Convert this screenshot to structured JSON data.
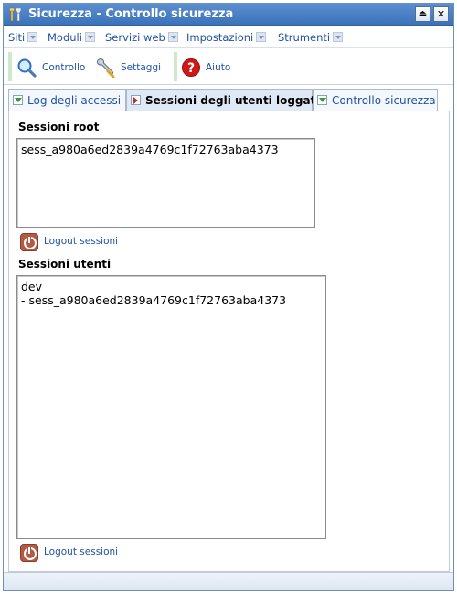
{
  "window": {
    "title": "Sicurezza - Controllo sicurezza",
    "icon": "tools-icon",
    "buttons": {
      "eject": "⏏",
      "close": "✕"
    }
  },
  "menubar": {
    "items": [
      {
        "label": "Siti"
      },
      {
        "label": "Moduli"
      },
      {
        "label": "Servizi web"
      },
      {
        "label": "Impostazioni"
      },
      {
        "label": "Strumenti"
      }
    ]
  },
  "toolbar": {
    "controllo": {
      "label": "Controllo",
      "icon": "magnifier-icon"
    },
    "settaggi": {
      "label": "Settaggi",
      "icon": "wrench-icon"
    },
    "aiuto": {
      "label": "Aiuto",
      "icon": "help-icon",
      "color": "#d01818"
    }
  },
  "tabs": [
    {
      "label": "Log degli accessi",
      "active": false
    },
    {
      "label": "Sessioni degli utenti loggati",
      "active": true
    },
    {
      "label": "Controllo sicurezza",
      "active": false
    }
  ],
  "root_sessions": {
    "label": "Sessioni root",
    "content": "sess_a980a6ed2839a4769c1f72763aba4373",
    "logout_label": "Logout sessioni"
  },
  "user_sessions": {
    "label": "Sessioni utenti",
    "content": "dev\n- sess_a980a6ed2839a4769c1f72763aba4373",
    "logout_label": "Logout sessioni"
  },
  "colors": {
    "accent": "#1f52a3",
    "titlebar": "#3c72b8",
    "logout_icon": "#b35a45"
  }
}
